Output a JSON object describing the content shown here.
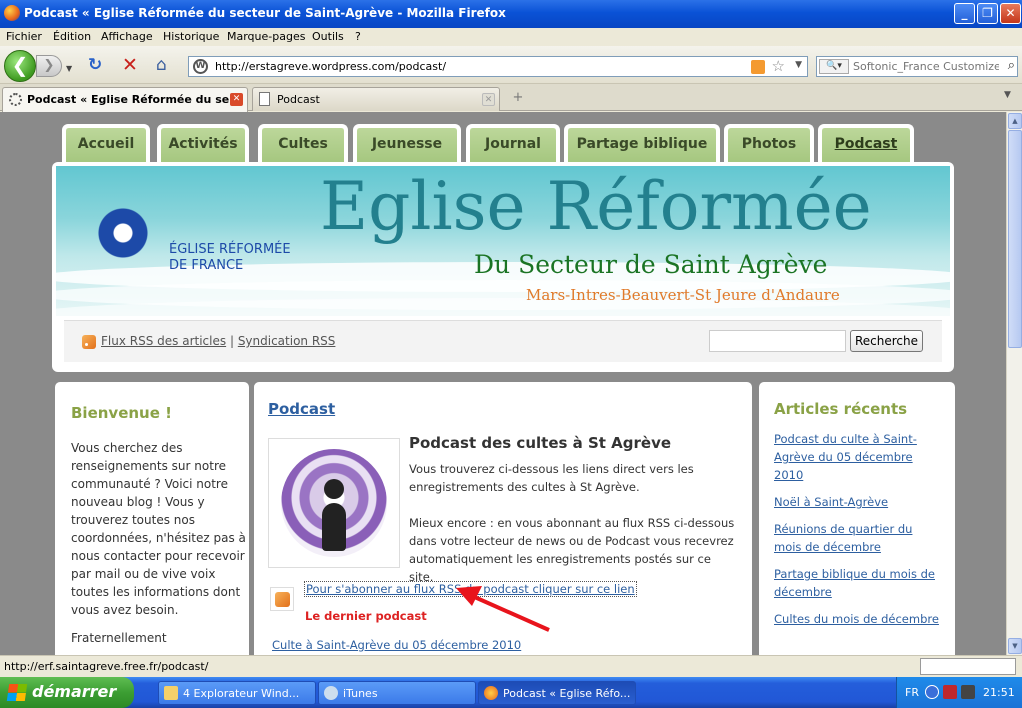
{
  "window": {
    "title": "Podcast « Eglise Réformée du secteur de Saint-Agrève - Mozilla Firefox",
    "minimize": "_",
    "maximize": "❐",
    "close": "✕"
  },
  "menu": [
    "Fichier",
    "Édition",
    "Affichage",
    "Historique",
    "Marque-pages",
    "Outils",
    "?"
  ],
  "toolbar": {
    "url": "http://erstagreve.wordpress.com/podcast/",
    "search_placeholder": "Softonic_France Customized W",
    "reload_icon": "reload-icon",
    "stop_icon": "stop-icon",
    "home_icon": "home-icon"
  },
  "tabs": [
    {
      "label": "Podcast « Eglise Réformée du se...",
      "active": true
    },
    {
      "label": "Podcast",
      "active": false
    }
  ],
  "site": {
    "nav": [
      "Accueil",
      "Activités",
      "Cultes",
      "Jeunesse",
      "Journal",
      "Partage biblique",
      "Photos",
      "Podcast"
    ],
    "banner": {
      "title": "Eglise Réformée",
      "erf_line1": "ÉGLISE RÉFORMÉE",
      "erf_line2": "DE FRANCE",
      "sector": "Du Secteur de Saint Agrève",
      "places": "Mars-Intres-Beauvert-St Jeure d'Andaure"
    },
    "subbar": {
      "rss_articles": "Flux RSS des articles",
      "separator": "|",
      "syndication": "Syndication RSS",
      "search_button": "Recherche"
    },
    "left": {
      "title": "Bienvenue !",
      "text": "Vous cherchez des renseignements sur notre communauté ? Voici notre nouveau blog ! Vous y trouverez toutes nos coordonnées, n'hésitez pas à nous contacter pour recevoir par mail ou de vive voix toutes les informations dont vous avez besoin.",
      "signoff": "Fraternellement"
    },
    "main": {
      "page_title": "Podcast",
      "heading": "Podcast des cultes à St Agrève",
      "para1": "Vous trouverez ci-dessous les liens direct vers les enregistrements des cultes à St Agrève.",
      "para2": "Mieux encore : en vous abonnant au flux RSS ci-dessous dans votre lecteur de news ou de Podcast vous recevrez automatiquement les enregistrements postés sur ce site.",
      "subscribe_link": "Pour s'abonner au flux RSS du podcast cliquer sur ce lien",
      "latest_label": "Le dernier podcast",
      "latest_link": "Culte à Saint-Agrève du 05 décembre 2010"
    },
    "right": {
      "title": "Articles récents",
      "links": [
        "Podcast du culte à Saint-Agrève du 05 décembre 2010",
        "Noël à Saint-Agrève",
        "Réunions de quartier du mois de décembre",
        "Partage biblique du mois de décembre",
        "Cultes du mois de décembre"
      ]
    }
  },
  "status": {
    "text": "http://erf.saintagreve.free.fr/podcast/"
  },
  "taskbar": {
    "start": "démarrer",
    "tasks": [
      {
        "label": "4 Explorateur Wind...",
        "active": false
      },
      {
        "label": "iTunes",
        "active": false
      },
      {
        "label": "Podcast « Eglise Réfo...",
        "active": true
      }
    ],
    "lang": "FR",
    "clock": "21:51"
  },
  "colors": {
    "accent_green": "#a4c67e",
    "link_blue": "#2d5fa0",
    "title_green": "#8aa246",
    "alert_red": "#d22222"
  }
}
